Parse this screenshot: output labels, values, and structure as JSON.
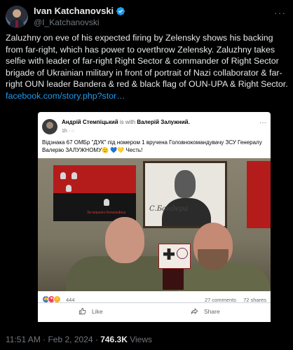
{
  "author": {
    "display_name": "Ivan Katchanovski",
    "handle": "@I_Katchanovski",
    "more_label": "···"
  },
  "tweet": {
    "text": "Zaluzhny on eve of his expected firing by Zelensky shows his backing from far-right, which has power to overthrow Zelensky. Zaluzhny takes selfie with leader of far-right Right Sector & commander of Right Sector brigade of Ukrainian military in front of portrait of Nazi collaborator & far-right OUN leader Bandera & red & black flag of OUN-UPA & Right Sector.",
    "link": "facebook.com/story.php?stor…"
  },
  "fb_post": {
    "author": "Андрій Стемпіцький",
    "with_word": "is with",
    "tagged": "Валерій Залужний.",
    "time": "1h · ",
    "more_label": "···",
    "text": "Відзнака 67 ОМБр \"ДУК\" під номером 1 вручена Головнокомандувачу ЗСУ Генералу Валерію ЗАЛУЖНОМУ🫡 💙💛 Честь!",
    "flag_caption": "За першого Батальйону",
    "portrait_signature": "С.Бандера",
    "reaction_count": "444",
    "comments": "27 comments",
    "shares": "72 shares",
    "like_label": "Like",
    "share_label": "Share"
  },
  "meta": {
    "time": "11:51 AM · Feb 2, 2024 · ",
    "views_count": "746.3K",
    "views_label": " Views"
  },
  "colors": {
    "accent": "#1d9bf0",
    "background": "#000000",
    "muted": "#71767b",
    "flag_red": "#b41c1c",
    "flag_black": "#151515"
  },
  "icons": [
    "verified-badge-icon",
    "more-icon",
    "like-icon",
    "share-icon",
    "like-reaction-icon",
    "love-reaction-icon",
    "care-reaction-icon"
  ]
}
